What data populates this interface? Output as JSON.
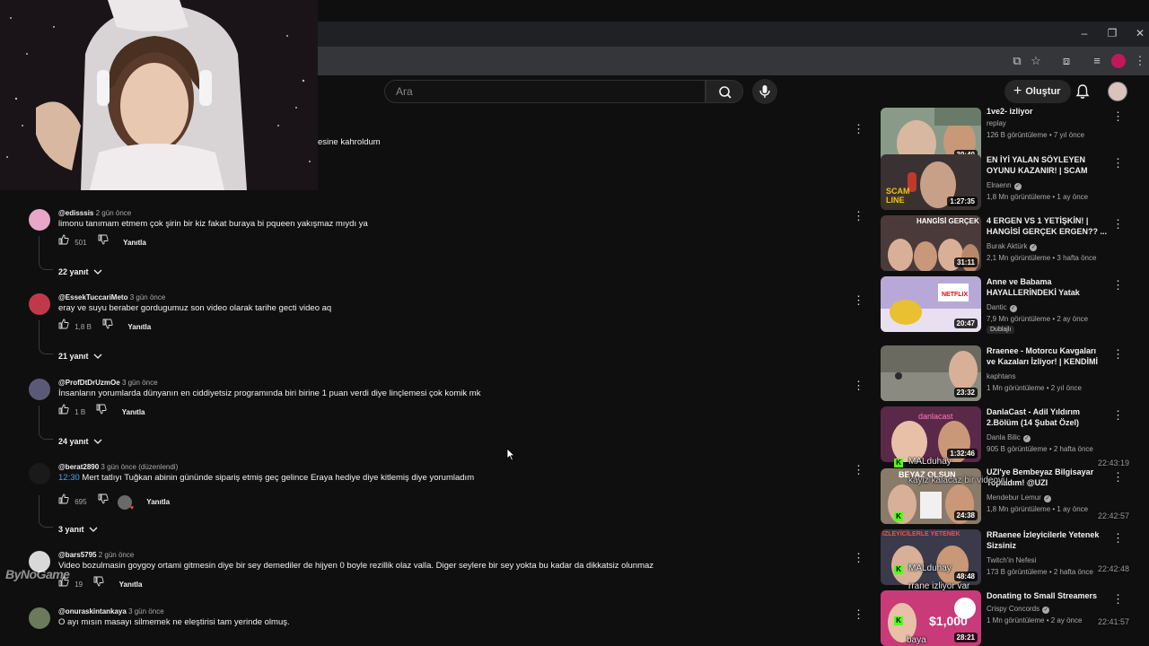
{
  "header": {
    "search_placeholder": "Ara",
    "create_label": "Oluştur"
  },
  "partial_comment": {
    "text": "esine kahroldum"
  },
  "comments": [
    {
      "author": "@edisssis",
      "time": "2 gün önce",
      "text": "limonu tanımam etmem çok şirin bir kiz fakat buraya bi pqueen yakışmaz mıydı ya",
      "likes": "501",
      "reply_label": "Yanıtla",
      "replies_label": "22 yanıt",
      "avatar_color": "#e8a6c8"
    },
    {
      "author": "@EssekTuccariMeto",
      "time": "3 gün önce",
      "text": "eray ve suyu beraber gordugumuz son video olarak tarihe gecti video aq",
      "likes": "1,8 B",
      "reply_label": "Yanıtla",
      "replies_label": "21 yanıt",
      "avatar_color": "#c0394b"
    },
    {
      "author": "@ProfDtDrUzmOe",
      "time": "3 gün önce",
      "text": "İnsanların yorumlarda dünyanın en ciddiyetsiz programında biri birine 1 puan verdi diye linçlemesi çok komik mk",
      "likes": "1 B",
      "reply_label": "Yanıtla",
      "replies_label": "24 yanıt",
      "avatar_color": "#5a5a78"
    },
    {
      "author": "@berat2890",
      "time": "3 gün önce (düzenlendi)",
      "timestamp_link": "12:30",
      "text": "Mert tatlıyı Tuğkan abinin gününde sipariş etmiş geç gelince Eraya hediye diye kitlemiş diye yorumladım",
      "likes": "695",
      "reply_label": "Yanıtla",
      "replies_label": "3 yanıt",
      "avatar_color": "#1a1a1a"
    },
    {
      "author": "@bars5795",
      "time": "2 gün önce",
      "text": "Video bozulmasin goygoy ortami gitmesin diye bir sey demediler de  hijyen 0 boyle rezillik olaz valla. Diger seylere bir sey yokta bu kadar da dikkatsiz olunmaz",
      "likes": "19",
      "reply_label": "Yanıtla",
      "avatar_color": "#d8d8d8"
    },
    {
      "author": "@onuraskintankaya",
      "time": "3 gün önce",
      "text": "O ayı mısın masayı silmemek ne eleştirisi tam yerinde olmuş.",
      "avatar_color": "#6b7a5a"
    }
  ],
  "sidebar": [
    {
      "title": "1ve2- izliyor",
      "channel": "replay",
      "meta": "126 B görüntüleme • 7 yıl önce",
      "duration": "39:40",
      "verified": false,
      "thumb_color": "#8a9a88"
    },
    {
      "title": "EN İYİ YALAN SÖYLEYEN OYUNU KAZANIR! | SCAM LIN...",
      "channel": "Elraenn",
      "meta": "1,8 Mn görüntüleme • 1 ay önce",
      "duration": "1:27:35",
      "verified": true,
      "thumb_color": "#3a3232"
    },
    {
      "title": "4 ERGEN VS 1 YETİŞKİN! | HANGİSİ GERÇEK ERGEN?? ...",
      "channel": "Burak Aktürk",
      "meta": "2,1 Mn görüntüleme • 3 hafta önce",
      "duration": "31:11",
      "verified": true,
      "thumb_color": "#4a3a3a",
      "thumb_text": "HANGİSİ GERÇEK"
    },
    {
      "title": "Anne ve Babama HAYALLERİNDEKİ Yatak Odası...",
      "channel": "Dantic",
      "meta": "7,9 Mn görüntüleme • 2 ay önce",
      "duration": "20:47",
      "verified": true,
      "badge": "Dublajlı",
      "thumb_color": "#b8a8d8"
    },
    {
      "title": "Rraenee - Motorcu Kavgaları ve Kazaları İzliyor! | KENDİMİ DE ...",
      "channel": "kaphtans",
      "meta": "1 Mn görüntüleme • 2 yıl önce",
      "duration": "23:32",
      "verified": false,
      "thumb_color": "#6a6a60"
    },
    {
      "title": "DanlaCast - Adil Yıldırım 2.Bölüm (14 Şubat Özel)",
      "channel": "Danla Bilic",
      "meta": "905 B görüntüleme • 2 hafta önce",
      "duration": "1:32:46",
      "verified": true,
      "thumb_color": "#5a2848",
      "thumb_text": "danlacast"
    },
    {
      "title": "UZI'ye Bembeyaz Bilgisayar Topladım! @UZI",
      "channel": "Mendebur Lemur",
      "meta": "1,8 Mn görüntüleme • 1 ay önce",
      "duration": "24:38",
      "verified": true,
      "thumb_color": "#8a7a6a",
      "thumb_text": "BEYAZ OLSUN"
    },
    {
      "title": "RRaenee İzleyicilerle Yetenek Sizsiniz",
      "channel": "Twitch'in Nefesi",
      "meta": "173 B görüntüleme • 2 hafta önce",
      "duration": "48:48",
      "verified": false,
      "thumb_color": "#3a3a4a",
      "thumb_text": "İZLEYİCİLERLE YETENEK"
    },
    {
      "title": "Donating to Small Streamers",
      "channel": "Crispy Concords",
      "meta": "1 Mn görüntüleme • 2 ay önce",
      "duration": "28:21",
      "verified": true,
      "thumb_color": "#c83a78",
      "thumb_text": "$1,000"
    }
  ],
  "stream_overlay": {
    "watermark": "ByNoGame",
    "chat": [
      {
        "user": "MALduhay",
        "text": "",
        "time": "22:43:19"
      },
      {
        "user": "",
        "text": "kayiz kalacaz bir videoyu",
        "time": "22:42:57"
      },
      {
        "user": "MALduhay",
        "text": "",
        "time": "22:42:48"
      },
      {
        "user": "",
        "text": "rrane izliyor var",
        "time": ""
      },
      {
        "user": "",
        "text": "baya",
        "time": "22:41:57"
      }
    ]
  },
  "colors": {
    "background": "#0f0f0f",
    "text_primary": "#f1f1f1",
    "text_secondary": "#aaaaaa",
    "link_blue": "#3ea6ff",
    "kick_green": "#53fc18"
  }
}
